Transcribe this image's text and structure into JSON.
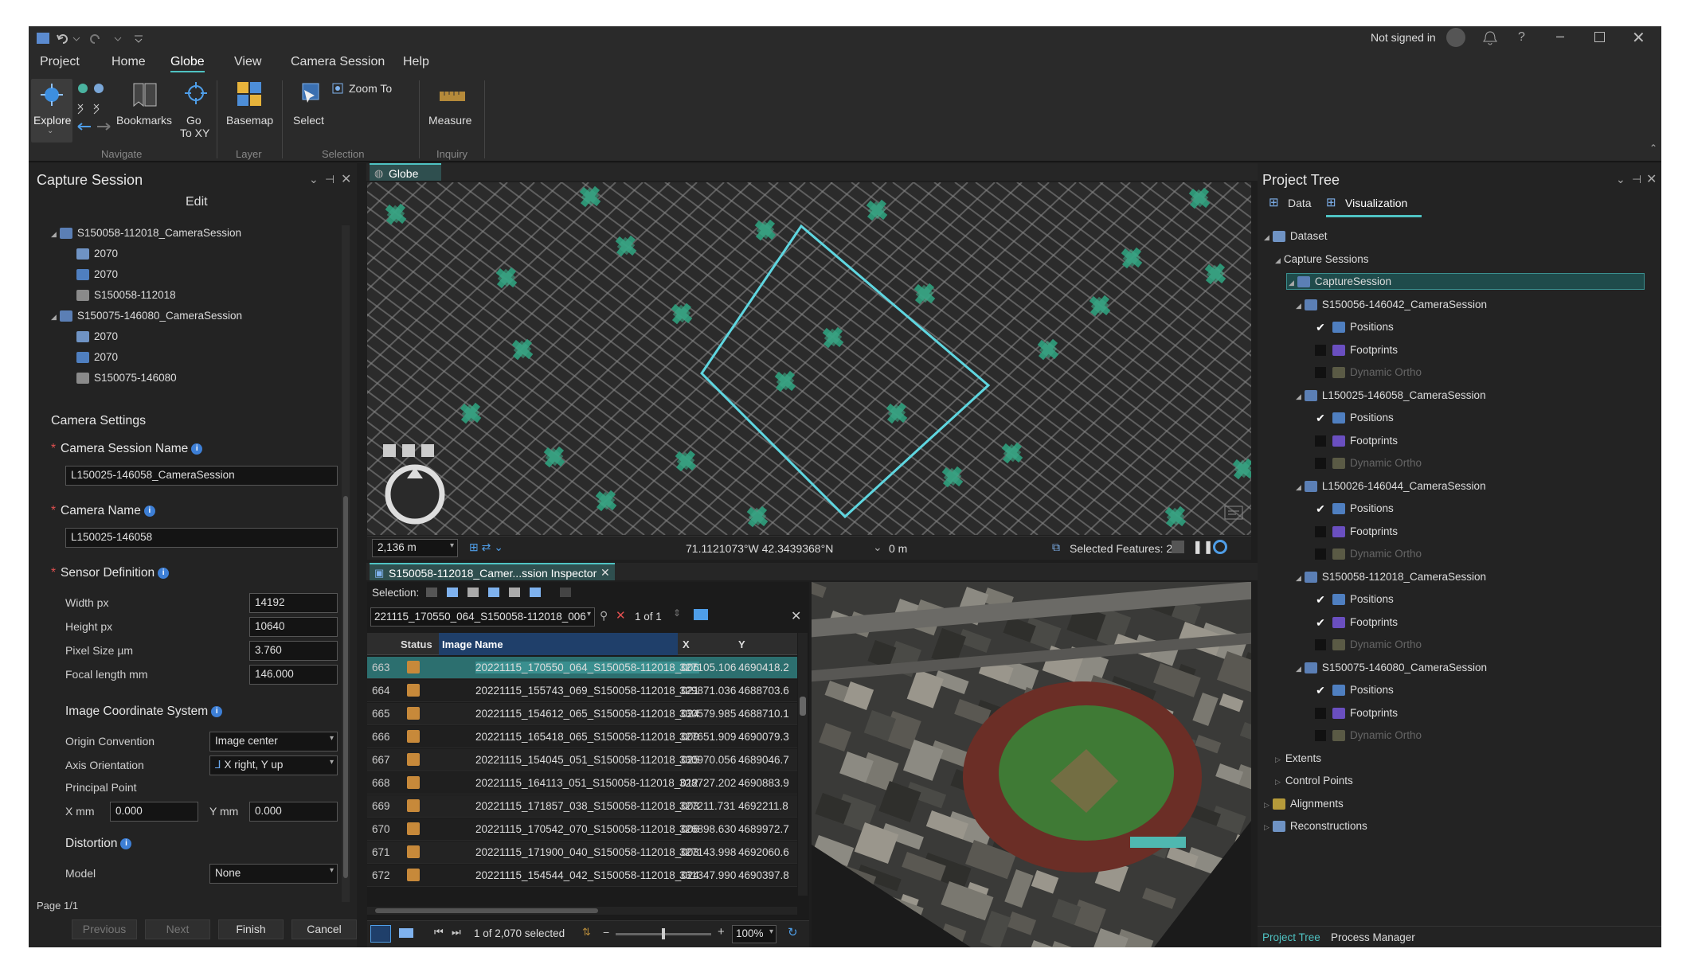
{
  "titlebar": {
    "signed_in": "Not signed in"
  },
  "ribbon": {
    "tabs": [
      "Project",
      "Home",
      "Globe",
      "View",
      "Camera Session",
      "Help"
    ],
    "buttons": {
      "explore": "Explore",
      "bookmarks": "Bookmarks",
      "go_to_xy": "Go\nTo XY",
      "basemap": "Basemap",
      "select": "Select",
      "zoom_to": "Zoom To",
      "measure": "Measure"
    },
    "groups": {
      "navigate": "Navigate",
      "layer": "Layer",
      "selection": "Selection",
      "inquiry": "Inquiry"
    }
  },
  "capture_panel": {
    "title": "Capture Session",
    "subtitle": "Edit",
    "tree": [
      {
        "label": "S150058-112018_CameraSession",
        "level": 0,
        "icon": "camera-session-icon"
      },
      {
        "label": "2070",
        "level": 1,
        "icon": "image-icon"
      },
      {
        "label": "2070",
        "level": 1,
        "icon": "positions-icon"
      },
      {
        "label": "S150058-112018",
        "level": 1,
        "icon": "camera-icon"
      },
      {
        "label": "S150075-146080_CameraSession",
        "level": 0,
        "icon": "camera-session-icon"
      },
      {
        "label": "2070",
        "level": 1,
        "icon": "image-icon"
      },
      {
        "label": "2070",
        "level": 1,
        "icon": "positions-icon"
      },
      {
        "label": "S150075-146080",
        "level": 1,
        "icon": "camera-icon"
      }
    ],
    "camera_settings": "Camera Settings",
    "camera_session_name_label": "Camera Session Name",
    "camera_session_name_value": "L150025-146058_CameraSession",
    "camera_name_label": "Camera Name",
    "camera_name_value": "L150025-146058",
    "sensor_definition": "Sensor Definition",
    "width_label": "Width px",
    "width_value": "14192",
    "height_label": "Height px",
    "height_value": "10640",
    "pixel_size_label": "Pixel Size µm",
    "pixel_size_value": "3.760",
    "focal_label": "Focal length mm",
    "focal_value": "146.000",
    "ics": "Image Coordinate System",
    "origin_label": "Origin Convention",
    "origin_value": "Image center",
    "axis_label": "Axis Orientation",
    "axis_value": "X right, Y up",
    "principal": "Principal Point",
    "xmm_label": "X mm",
    "xmm_value": "0.000",
    "ymm_label": "Y mm",
    "ymm_value": "0.000",
    "distortion": "Distortion",
    "model_label": "Model",
    "model_value": "None",
    "page": "Page 1/1",
    "previous": "Previous",
    "next": "Next",
    "finish": "Finish",
    "cancel": "Cancel"
  },
  "globe": {
    "tab": "Globe",
    "scale": "2,136 m",
    "coords": "71.1121073°W 42.3439368°N",
    "elev": "0 m",
    "selected": "Selected Features: 2"
  },
  "inspector": {
    "tab": "S150058-112018_Camer...ssion Inspector",
    "selection_label": "Selection:",
    "search_value": "221115_170550_064_S150058-112018_006",
    "match": "1 of 1",
    "columns": [
      "Status",
      "Image Name",
      "X",
      "Y"
    ],
    "rows": [
      {
        "id": "663",
        "name": "20221115_170550_064_S150058-112018_006",
        "x": "327105.106",
        "y": "4690418.2"
      },
      {
        "id": "664",
        "name": "20221115_155743_069_S150058-112018_021",
        "x": "329871.036",
        "y": "4688703.6"
      },
      {
        "id": "665",
        "name": "20221115_154612_065_S150058-112018_024",
        "x": "330579.985",
        "y": "4688710.1"
      },
      {
        "id": "666",
        "name": "20221115_165418_065_S150058-112018_009",
        "x": "327651.909",
        "y": "4690079.3"
      },
      {
        "id": "667",
        "name": "20221115_154045_051_S150058-112018_025",
        "x": "330970.056",
        "y": "4689046.7"
      },
      {
        "id": "668",
        "name": "20221115_164113_051_S150058-112018_012",
        "x": "328727.202",
        "y": "4690883.9"
      },
      {
        "id": "669",
        "name": "20221115_171857_038_S150058-112018_003",
        "x": "327211.731",
        "y": "4692211.8"
      },
      {
        "id": "670",
        "name": "20221115_170542_070_S150058-112018_006",
        "x": "326898.630",
        "y": "4689972.7"
      },
      {
        "id": "671",
        "name": "20221115_171900_040_S150058-112018_003",
        "x": "327143.998",
        "y": "4692060.6"
      },
      {
        "id": "672",
        "name": "20221115_154544_042_S150058-112018_024",
        "x": "331347.990",
        "y": "4690397.8"
      }
    ],
    "footer_count": "1 of 2,070 selected",
    "zoom": "100%"
  },
  "project_tree": {
    "title": "Project Tree",
    "tab_data": "Data",
    "tab_vis": "Visualization",
    "dataset": "Dataset",
    "capture_sessions": "Capture Sessions",
    "capture_session": "CaptureSession",
    "sessions": [
      {
        "name": "S150056-146042_CameraSession",
        "positions": true,
        "footprints": false
      },
      {
        "name": "L150025-146058_CameraSession",
        "positions": true,
        "footprints": false
      },
      {
        "name": "L150026-146044_CameraSession",
        "positions": true,
        "footprints": false
      },
      {
        "name": "S150058-112018_CameraSession",
        "positions": true,
        "footprints": true
      },
      {
        "name": "S150075-146080_CameraSession",
        "positions": true,
        "footprints": false
      }
    ],
    "positions": "Positions",
    "footprints": "Footprints",
    "dynamic_ortho": "Dynamic Ortho",
    "extents": "Extents",
    "control_points": "Control Points",
    "alignments": "Alignments",
    "reconstructions": "Reconstructions",
    "bottom_tab_tree": "Project Tree",
    "bottom_tab_process": "Process Manager"
  }
}
